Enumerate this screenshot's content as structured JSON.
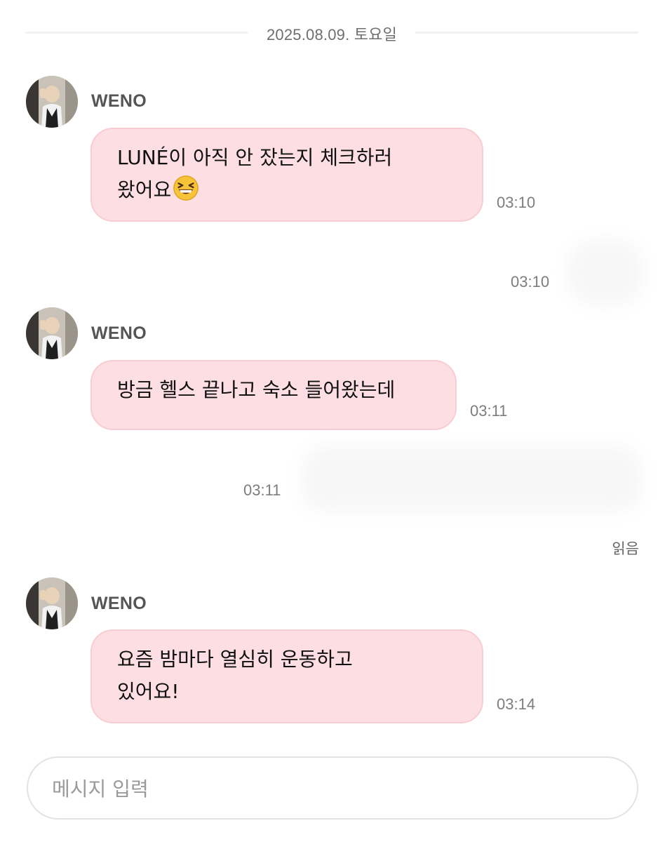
{
  "date_separator": "2025.08.09. 토요일",
  "messages": [
    {
      "sender": "WENO",
      "lines": [
        "LUNÉ이 아직 안 잤는지 체크하러",
        "왔어요"
      ],
      "emoji": "laughing-emoji",
      "time": "03:10"
    },
    {
      "sender": "WENO",
      "lines": [
        "방금 헬스 끝나고 숙소 들어왔는데"
      ],
      "time": "03:11"
    },
    {
      "sender": "WENO",
      "lines": [
        "요즘 밤마다 열심히 운동하고",
        "있어요!"
      ],
      "time": "03:14"
    }
  ],
  "outgoing": [
    {
      "time": "03:10"
    },
    {
      "time": "03:11"
    }
  ],
  "read_status": "읽음",
  "composer": {
    "placeholder": "메시지 입력"
  },
  "colors": {
    "bubble_bg": "#fddfe3",
    "bubble_border": "#f9ccd3",
    "time_text": "#7d7d7d",
    "sender_text": "#555555"
  }
}
